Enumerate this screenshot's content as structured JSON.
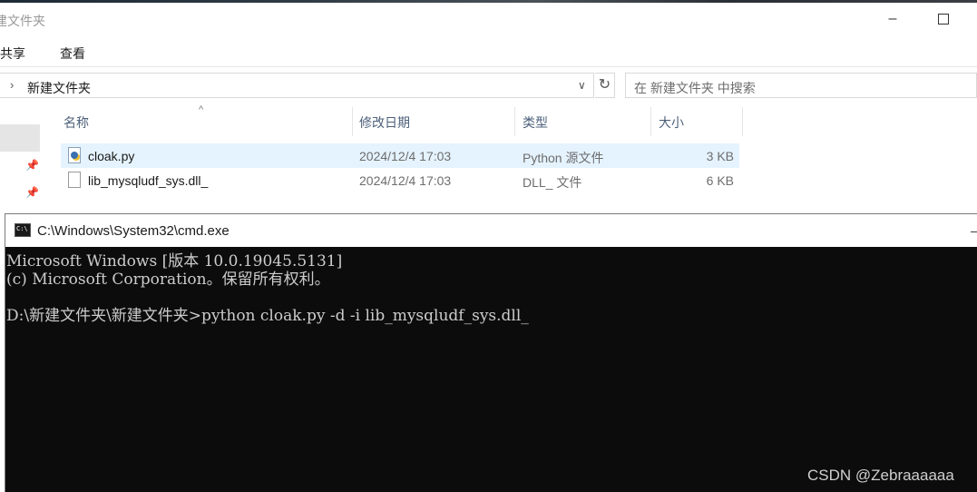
{
  "explorer": {
    "title": "建文件夹",
    "ribbon_tabs": [
      "共享",
      "查看"
    ],
    "address": "新建文件夹",
    "search_placeholder": "在 新建文件夹 中搜索",
    "columns": {
      "name": "名称",
      "modified": "修改日期",
      "type": "类型",
      "size": "大小"
    },
    "files": [
      {
        "name": "cloak.py",
        "modified": "2024/12/4 17:03",
        "type": "Python 源文件",
        "size": "3 KB",
        "icon": "python-file-icon"
      },
      {
        "name": "lib_mysqludf_sys.dll_",
        "modified": "2024/12/4 17:03",
        "type": "DLL_ 文件",
        "size": "6 KB",
        "icon": "generic-file-icon"
      }
    ]
  },
  "cmd": {
    "title": "C:\\Windows\\System32\\cmd.exe",
    "lines": [
      "Microsoft Windows [版本 10.0.19045.5131]",
      "(c) Microsoft Corporation。保留所有权利。",
      "D:\\新建文件夹\\新建文件夹>python cloak.py -d -i lib_mysqludf_sys.dll_"
    ]
  },
  "watermark": "CSDN @Zebraaaaaa"
}
